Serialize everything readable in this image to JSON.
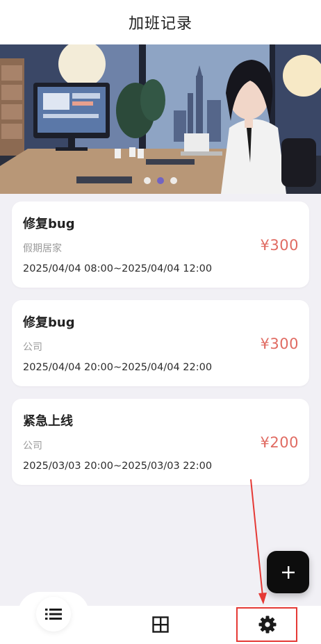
{
  "header": {
    "title": "加班记录"
  },
  "banner": {
    "dot_count": 3,
    "active_dot": 1
  },
  "records": [
    {
      "title": "修复bug",
      "place": "假期居家",
      "time": "2025/04/04 08:00~2025/04/04 12:00",
      "amount": "¥300"
    },
    {
      "title": "修复bug",
      "place": "公司",
      "time": "2025/04/04 20:00~2025/04/04 22:00",
      "amount": "¥300"
    },
    {
      "title": "紧急上线",
      "place": "公司",
      "time": "2025/03/03 20:00~2025/03/03 22:00",
      "amount": "¥200"
    }
  ],
  "fab": {
    "icon": "plus-icon"
  },
  "tabbar": {
    "items": [
      {
        "icon": "list-icon",
        "active": true
      },
      {
        "icon": "grid-icon",
        "active": false
      },
      {
        "icon": "gear-icon",
        "active": false
      }
    ]
  },
  "colors": {
    "amount": "#e06b62",
    "background": "#f1f0f5",
    "fab": "#0d0d0d",
    "annotation": "#e53935",
    "active_dot": "#6b5fc9"
  }
}
